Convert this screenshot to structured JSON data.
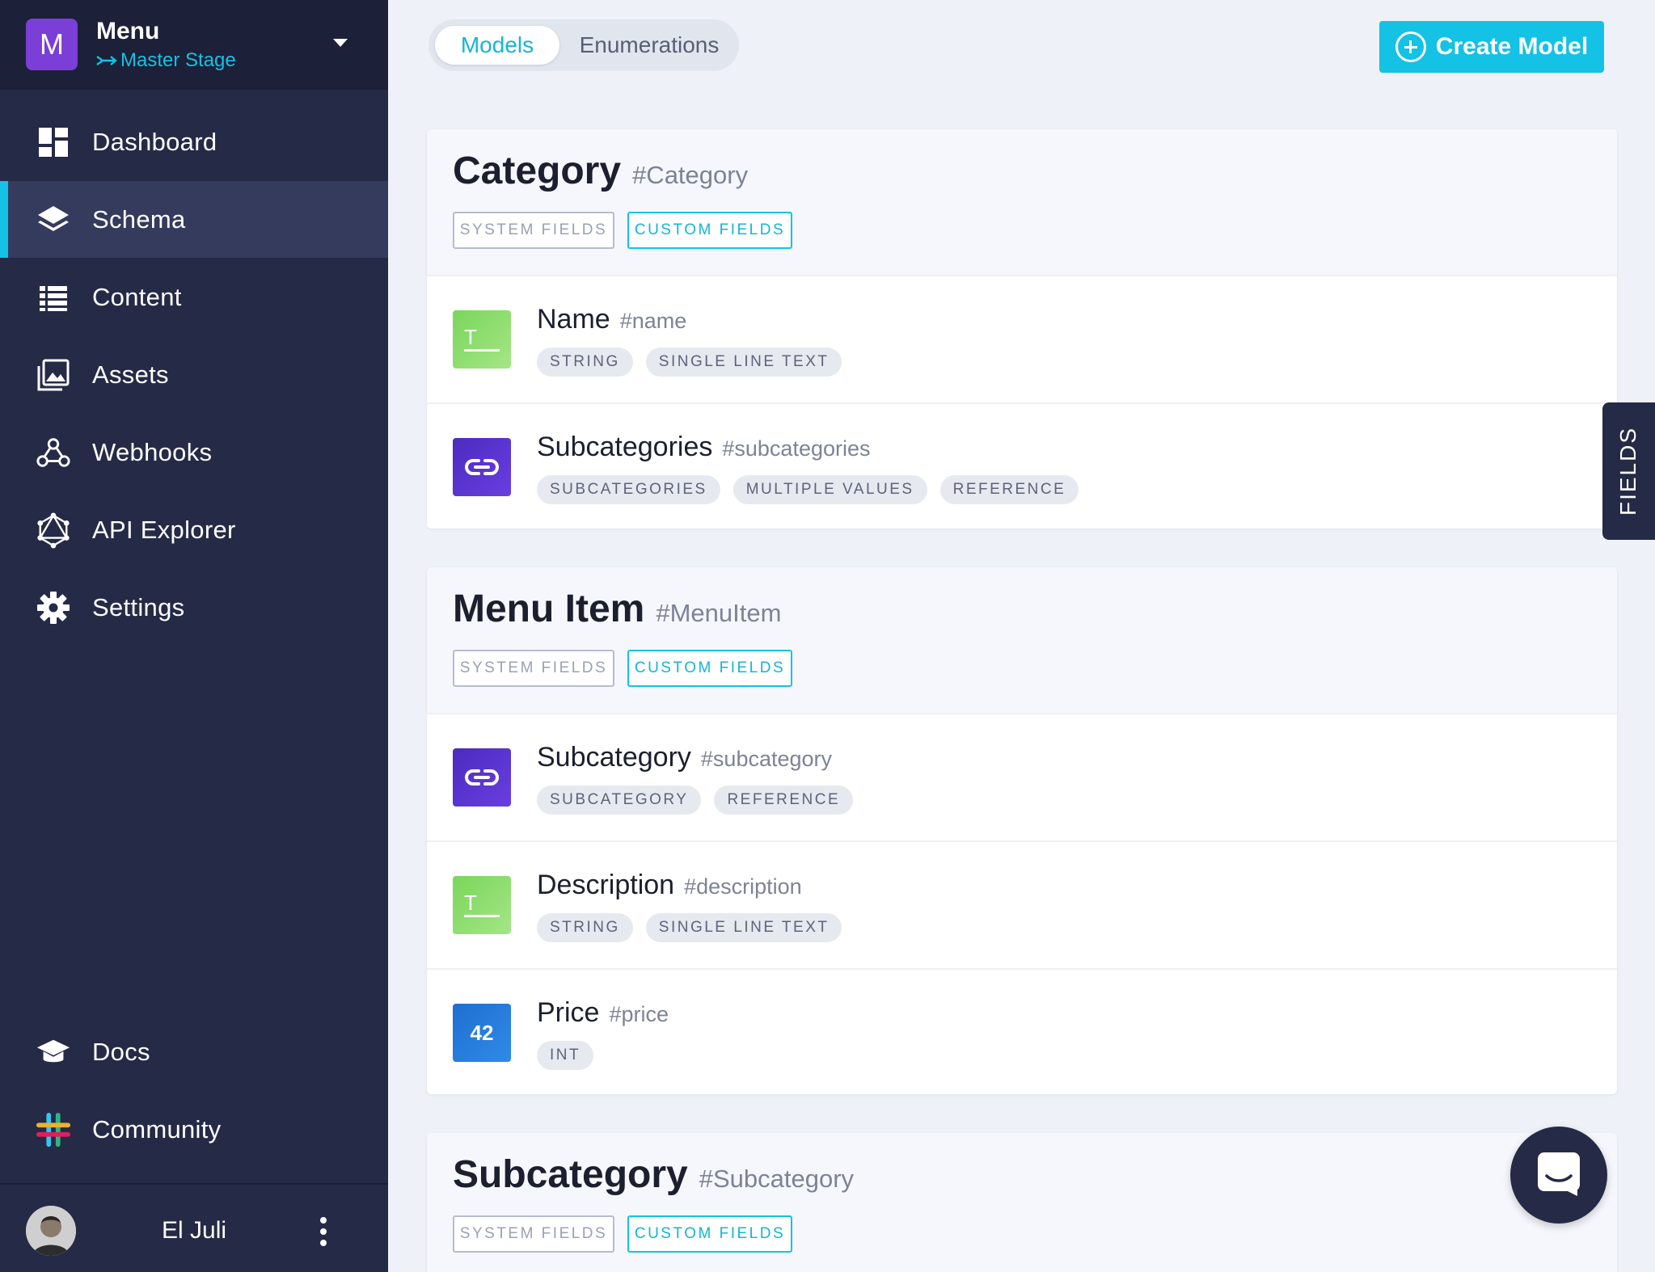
{
  "project": {
    "avatar_letter": "M",
    "name": "Menu",
    "stage": "Master Stage"
  },
  "nav": {
    "items": [
      {
        "label": "Dashboard",
        "icon": "dashboard-icon"
      },
      {
        "label": "Schema",
        "icon": "layers-icon",
        "active": true
      },
      {
        "label": "Content",
        "icon": "list-icon"
      },
      {
        "label": "Assets",
        "icon": "image-icon"
      },
      {
        "label": "Webhooks",
        "icon": "webhook-icon"
      },
      {
        "label": "API Explorer",
        "icon": "graphql-icon"
      },
      {
        "label": "Settings",
        "icon": "gear-icon"
      }
    ],
    "bottom": [
      {
        "label": "Docs",
        "icon": "graduation-cap-icon"
      },
      {
        "label": "Community",
        "icon": "slack-icon"
      }
    ]
  },
  "user": {
    "name": "El Juli"
  },
  "topbar": {
    "tabs": [
      "Models",
      "Enumerations"
    ],
    "create_label": "Create Model"
  },
  "fields_tab_label": "FIELDS",
  "models": [
    {
      "name": "Category",
      "api": "#Category",
      "system_label": "SYSTEM FIELDS",
      "custom_label": "CUSTOM FIELDS",
      "fields": [
        {
          "name": "Name",
          "api": "#name",
          "icon": "text-field-icon",
          "chips": [
            "STRING",
            "SINGLE LINE TEXT"
          ]
        },
        {
          "name": "Subcategories",
          "api": "#subcategories",
          "icon": "link-icon",
          "chips": [
            "SUBCATEGORIES",
            "MULTIPLE VALUES",
            "REFERENCE"
          ]
        }
      ]
    },
    {
      "name": "Menu Item",
      "api": "#MenuItem",
      "system_label": "SYSTEM FIELDS",
      "custom_label": "CUSTOM FIELDS",
      "fields": [
        {
          "name": "Subcategory",
          "api": "#subcategory",
          "icon": "link-icon",
          "chips": [
            "SUBCATEGORY",
            "REFERENCE"
          ]
        },
        {
          "name": "Description",
          "api": "#description",
          "icon": "text-field-icon",
          "chips": [
            "STRING",
            "SINGLE LINE TEXT"
          ]
        },
        {
          "name": "Price",
          "api": "#price",
          "icon": "number-icon",
          "icon_text": "42",
          "chips": [
            "INT"
          ]
        }
      ]
    },
    {
      "name": "Subcategory",
      "api": "#Subcategory",
      "system_label": "SYSTEM FIELDS",
      "custom_label": "CUSTOM FIELDS",
      "fields": []
    }
  ]
}
